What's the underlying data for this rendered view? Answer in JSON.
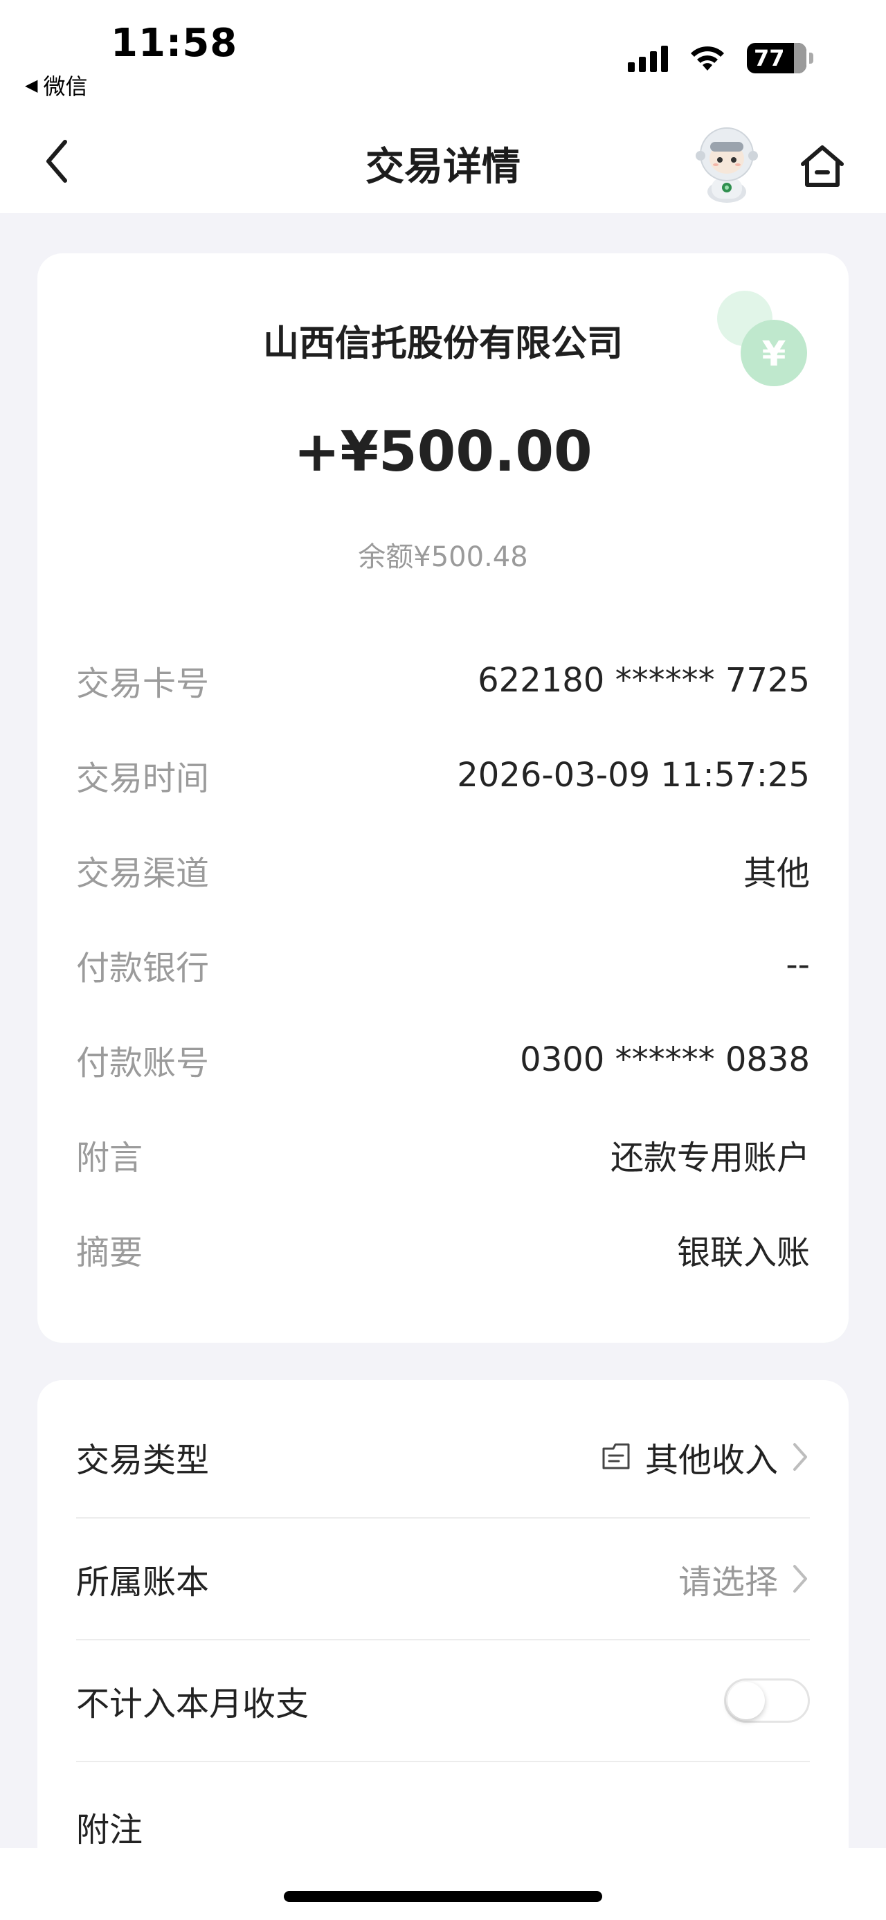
{
  "status_bar": {
    "time": "11:58",
    "back_app": "微信",
    "battery": "77"
  },
  "nav": {
    "title": "交易详情",
    "icons": [
      "chevron-left-icon",
      "robot-assistant-icon",
      "home-icon"
    ]
  },
  "transaction": {
    "merchant": "山西信托股份有限公司",
    "amount": "+¥500.00",
    "balance": "余额¥500.48",
    "details": [
      {
        "label": "交易卡号",
        "value": "622180 ****** 7725"
      },
      {
        "label": "交易时间",
        "value": "2026-03-09 11:57:25"
      },
      {
        "label": "交易渠道",
        "value": "其他"
      },
      {
        "label": "付款银行",
        "value": "--"
      },
      {
        "label": "付款账号",
        "value": "0300 ****** 0838"
      },
      {
        "label": "附言",
        "value": "还款专用账户"
      },
      {
        "label": "摘要",
        "value": "银联入账"
      }
    ]
  },
  "options": {
    "type_label": "交易类型",
    "type_value": "其他收入",
    "book_label": "所属账本",
    "book_value": "请选择",
    "exclude_label": "不计入本月收支",
    "exclude_on": false,
    "note_label": "附注"
  },
  "colors": {
    "accent_green": "#3fbf73",
    "label_gray": "#9b9b9b",
    "background": "#f3f3f8"
  }
}
